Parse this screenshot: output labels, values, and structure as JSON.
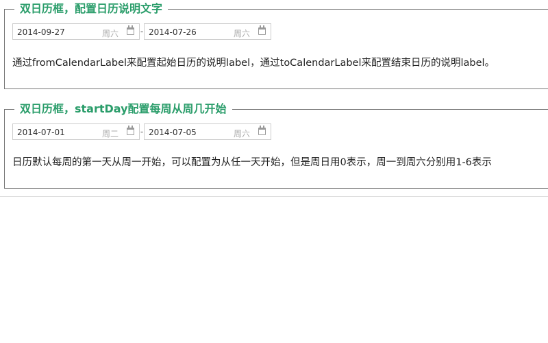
{
  "sections": [
    {
      "title": "双日历框，配置日历说明文字",
      "from": {
        "date": "2014-09-27",
        "weekday": "周六"
      },
      "separator": "-",
      "to": {
        "date": "2014-07-26",
        "weekday": "周六"
      },
      "description": "通过fromCalendarLabel来配置起始日历的说明label，通过toCalendarLabel来配置结束日历的说明label。"
    },
    {
      "title": "双日历框，startDay配置每周从周几开始",
      "from": {
        "date": "2014-07-01",
        "weekday": "周二"
      },
      "separator": "-",
      "to": {
        "date": "2014-07-05",
        "weekday": "周六"
      },
      "description": "日历默认每周的第一天从周一开始，可以配置为从任一天开始，但是周日用0表示，周一到周六分别用1-6表示"
    }
  ],
  "colors": {
    "legend": "#2a9d6a",
    "border": "#777777",
    "input_border": "#cccccc"
  },
  "icons": {
    "calendar": "calendar-icon"
  }
}
